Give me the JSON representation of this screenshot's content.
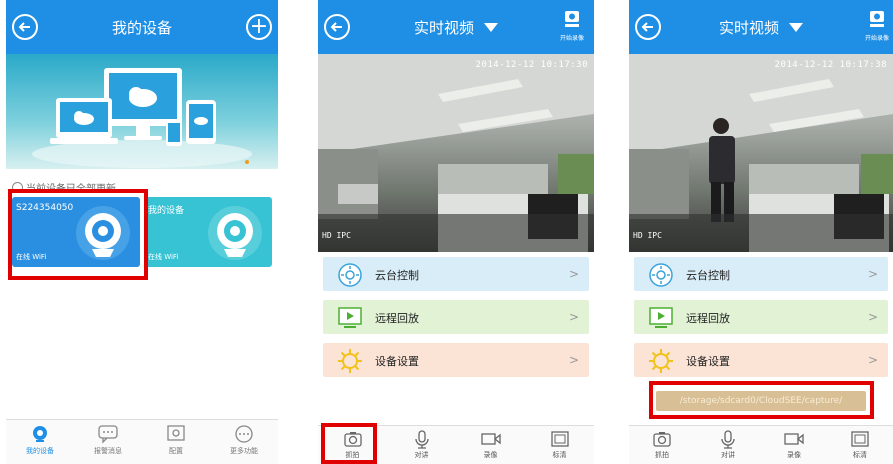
{
  "screen1": {
    "title": "我的设备",
    "notice": "当前设备已全部更新",
    "devices": [
      {
        "name": "S224354050",
        "status": "在线 WiFi"
      },
      {
        "name": "我的设备",
        "status": "在线 WiFi"
      }
    ],
    "tabs": [
      {
        "label": "我的设备",
        "icon": "camera-icon"
      },
      {
        "label": "报警消息",
        "icon": "message-icon"
      },
      {
        "label": "配置",
        "icon": "config-icon"
      },
      {
        "label": "更多功能",
        "icon": "more-icon"
      }
    ]
  },
  "screen2": {
    "title": "实时视频",
    "record_label": "开始录像",
    "timestamp": "2014-12-12 10:17:30",
    "video_label": "HD IPC",
    "menu": [
      {
        "label": "云台控制",
        "icon": "ptz-icon",
        "color": "#d8edf8"
      },
      {
        "label": "远程回放",
        "icon": "playback-icon",
        "color": "#e2f2d5"
      },
      {
        "label": "设备设置",
        "icon": "settings-sun-icon",
        "color": "#fbe3d6"
      }
    ],
    "tools": [
      {
        "label": "抓拍",
        "icon": "snapshot-icon"
      },
      {
        "label": "对讲",
        "icon": "mic-icon"
      },
      {
        "label": "录像",
        "icon": "video-record-icon"
      },
      {
        "label": "标清",
        "icon": "quality-icon"
      }
    ]
  },
  "screen3": {
    "title": "实时视频",
    "record_label": "开始录像",
    "timestamp": "2014-12-12 10:17:38",
    "video_label": "HD IPC",
    "menu": [
      {
        "label": "云台控制",
        "icon": "ptz-icon"
      },
      {
        "label": "远程回放",
        "icon": "playback-icon"
      },
      {
        "label": "设备设置",
        "icon": "settings-sun-icon"
      }
    ],
    "capture_path": "/storage/sdcard0/CloudSEE/capture/",
    "tools": [
      {
        "label": "抓拍",
        "icon": "snapshot-icon"
      },
      {
        "label": "对讲",
        "icon": "mic-icon"
      },
      {
        "label": "录像",
        "icon": "video-record-icon"
      },
      {
        "label": "标清",
        "icon": "quality-icon"
      }
    ]
  },
  "colors": {
    "header_blue": "#1f8fe6",
    "highlight_red": "#e00000",
    "device_card": "#2a8fe0",
    "device_card2": "#38c3d4"
  }
}
